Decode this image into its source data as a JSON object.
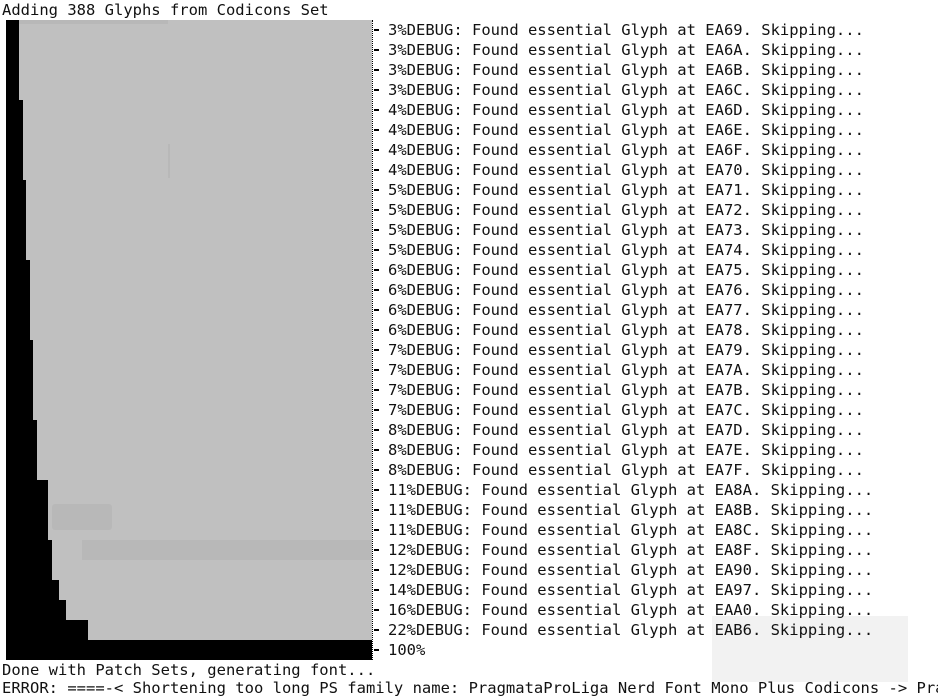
{
  "terminal": {
    "header_line": "Adding 388 Glyphs from Codicons Set",
    "footer_done_line": "Done with Patch Sets, generating font...",
    "footer_error_line": "ERROR: ====-< Shortening too long PS family name: PragmataProLiga Nerd Font Mono Plus Codicons -> Pragma"
  },
  "progress": {
    "final_label": "100%"
  },
  "log_lines": [
    "3%DEBUG: Found essential Glyph at EA69. Skipping...",
    "3%DEBUG: Found essential Glyph at EA6A. Skipping...",
    "3%DEBUG: Found essential Glyph at EA6B. Skipping...",
    "3%DEBUG: Found essential Glyph at EA6C. Skipping...",
    "4%DEBUG: Found essential Glyph at EA6D. Skipping...",
    "4%DEBUG: Found essential Glyph at EA6E. Skipping...",
    "4%DEBUG: Found essential Glyph at EA6F. Skipping...",
    "4%DEBUG: Found essential Glyph at EA70. Skipping...",
    "5%DEBUG: Found essential Glyph at EA71. Skipping...",
    "5%DEBUG: Found essential Glyph at EA72. Skipping...",
    "5%DEBUG: Found essential Glyph at EA73. Skipping...",
    "5%DEBUG: Found essential Glyph at EA74. Skipping...",
    "6%DEBUG: Found essential Glyph at EA75. Skipping...",
    "6%DEBUG: Found essential Glyph at EA76. Skipping...",
    "6%DEBUG: Found essential Glyph at EA77. Skipping...",
    "6%DEBUG: Found essential Glyph at EA78. Skipping...",
    "7%DEBUG: Found essential Glyph at EA79. Skipping...",
    "7%DEBUG: Found essential Glyph at EA7A. Skipping...",
    "7%DEBUG: Found essential Glyph at EA7B. Skipping...",
    "7%DEBUG: Found essential Glyph at EA7C. Skipping...",
    "8%DEBUG: Found essential Glyph at EA7D. Skipping...",
    "8%DEBUG: Found essential Glyph at EA7E. Skipping...",
    "8%DEBUG: Found essential Glyph at EA7F. Skipping...",
    "11%DEBUG: Found essential Glyph at EA8A. Skipping...",
    "11%DEBUG: Found essential Glyph at EA8B. Skipping...",
    "11%DEBUG: Found essential Glyph at EA8C. Skipping...",
    "12%DEBUG: Found essential Glyph at EA8F. Skipping...",
    "12%DEBUG: Found essential Glyph at EA90. Skipping...",
    "14%DEBUG: Found essential Glyph at EA97. Skipping...",
    "16%DEBUG: Found essential Glyph at EAA0. Skipping...",
    "22%DEBUG: Found essential Glyph at EAB6. Skipping..."
  ],
  "colors": {
    "terminal_background": "#ffffff",
    "terminal_text": "#111111",
    "progress_fill": "#000000",
    "progress_background": "#c0c0c0"
  }
}
